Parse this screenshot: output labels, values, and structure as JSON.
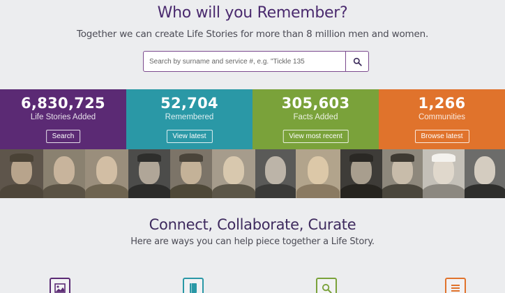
{
  "hero": {
    "title": "Who will you Remember?",
    "subtitle": "Together we can create Life Stories for more than 8 million men and women."
  },
  "search": {
    "placeholder": "Search by surname and service #, e.g. \"Tickle 135",
    "button_icon": "search-icon"
  },
  "stats": [
    {
      "number": "6,830,725",
      "label": "Life Stories Added",
      "button": "Search",
      "color": "#5b2a74"
    },
    {
      "number": "52,704",
      "label": "Remembered",
      "button": "View latest",
      "color": "#2a98a6"
    },
    {
      "number": "305,603",
      "label": "Facts Added",
      "button": "View most recent",
      "color": "#7aa23a"
    },
    {
      "number": "1,266",
      "label": "Communities",
      "button": "Browse latest",
      "color": "#e0732c"
    }
  ],
  "portrait_strip": {
    "icon": "portrait-photo"
  },
  "section": {
    "title": "Connect, Collaborate, Curate",
    "subtitle": "Here are ways you can help piece together a Life Story."
  },
  "features": [
    {
      "icon": "image-icon",
      "color": "#5b2a74"
    },
    {
      "icon": "book-icon",
      "color": "#2a98a6"
    },
    {
      "icon": "search-icon",
      "color": "#7aa23a"
    },
    {
      "icon": "list-icon",
      "color": "#e0732c"
    }
  ]
}
